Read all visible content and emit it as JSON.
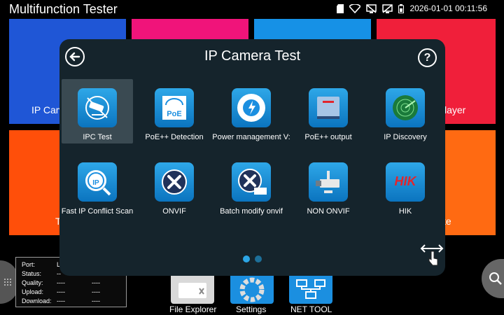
{
  "app": {
    "title": "Multifunction Tester"
  },
  "status": {
    "datetime": "2026-01-01 00:11:56"
  },
  "background_tiles": [
    {
      "label": "IP Cam",
      "color": "#1f56d6"
    },
    {
      "label": "",
      "color": "#f0147a"
    },
    {
      "label": "",
      "color": "#1691e6"
    },
    {
      "label": "layer",
      "color": "#f01f3a"
    },
    {
      "label": "T",
      "color": "#ff4f0a"
    },
    {
      "label": "te",
      "color": "#ff6a12"
    }
  ],
  "modal": {
    "title": "IP Camera Test",
    "items": [
      {
        "label": "IPC Test",
        "icon": "cctv-camera-icon"
      },
      {
        "label": "PoE++ Detection",
        "icon": "poe-meter-icon"
      },
      {
        "label": "Power management V:",
        "icon": "power-management-icon"
      },
      {
        "label": "PoE++ output",
        "icon": "poe-output-icon"
      },
      {
        "label": "IP Discovery",
        "icon": "radar-icon"
      },
      {
        "label": "Fast IP Conflict Scan",
        "icon": "ip-scan-icon"
      },
      {
        "label": "ONVIF",
        "icon": "onvif-tools-icon"
      },
      {
        "label": "Batch modify onvif",
        "icon": "batch-onvif-icon"
      },
      {
        "label": "NON ONVIF",
        "icon": "bullet-camera-icon"
      },
      {
        "label": "HIK",
        "icon": "hik-logo-icon",
        "logo_text": "HIK"
      }
    ]
  },
  "info_panel": {
    "rows": [
      {
        "label": "Port:",
        "value": "L",
        "value2": ""
      },
      {
        "label": "Status:",
        "value": "--",
        "value2": ""
      },
      {
        "label": "Quality:",
        "value": "----",
        "value2": "----"
      },
      {
        "label": "Upload:",
        "value": "----",
        "value2": "----"
      },
      {
        "label": "Download:",
        "value": "----",
        "value2": "----"
      }
    ]
  },
  "dock": {
    "file_explorer": "File Explorer",
    "settings": "Settings",
    "net_tool": "NET TOOL"
  },
  "colors": {
    "modal_bg": "#15242c",
    "icon_blue": "#1b8fe0",
    "hik_red": "#e3252c"
  }
}
